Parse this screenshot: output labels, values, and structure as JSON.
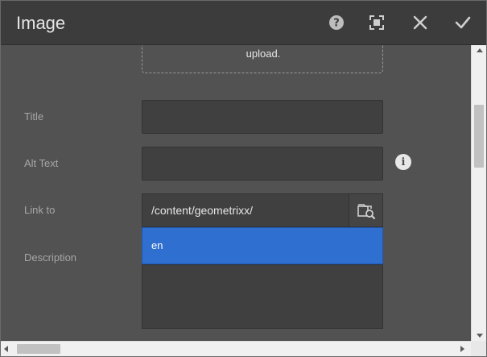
{
  "dialog": {
    "title": "Image",
    "buttons": {
      "help": "help-icon",
      "fullscreen": "fullscreen-icon",
      "close": "close-icon",
      "done": "checkmark-icon"
    }
  },
  "upload": {
    "text": "upload."
  },
  "form": {
    "title_label": "Title",
    "title_value": "",
    "alt_label": "Alt Text",
    "alt_value": "",
    "link_label": "Link to",
    "link_value": "/content/geometrixx/",
    "description_label": "Description",
    "description_value": ""
  },
  "autocomplete": {
    "items": [
      "en"
    ],
    "highlight_color": "#2f6fcf"
  },
  "colors": {
    "header_bg": "#3c3c3c",
    "body_bg": "#525252",
    "field_bg": "#404040"
  }
}
